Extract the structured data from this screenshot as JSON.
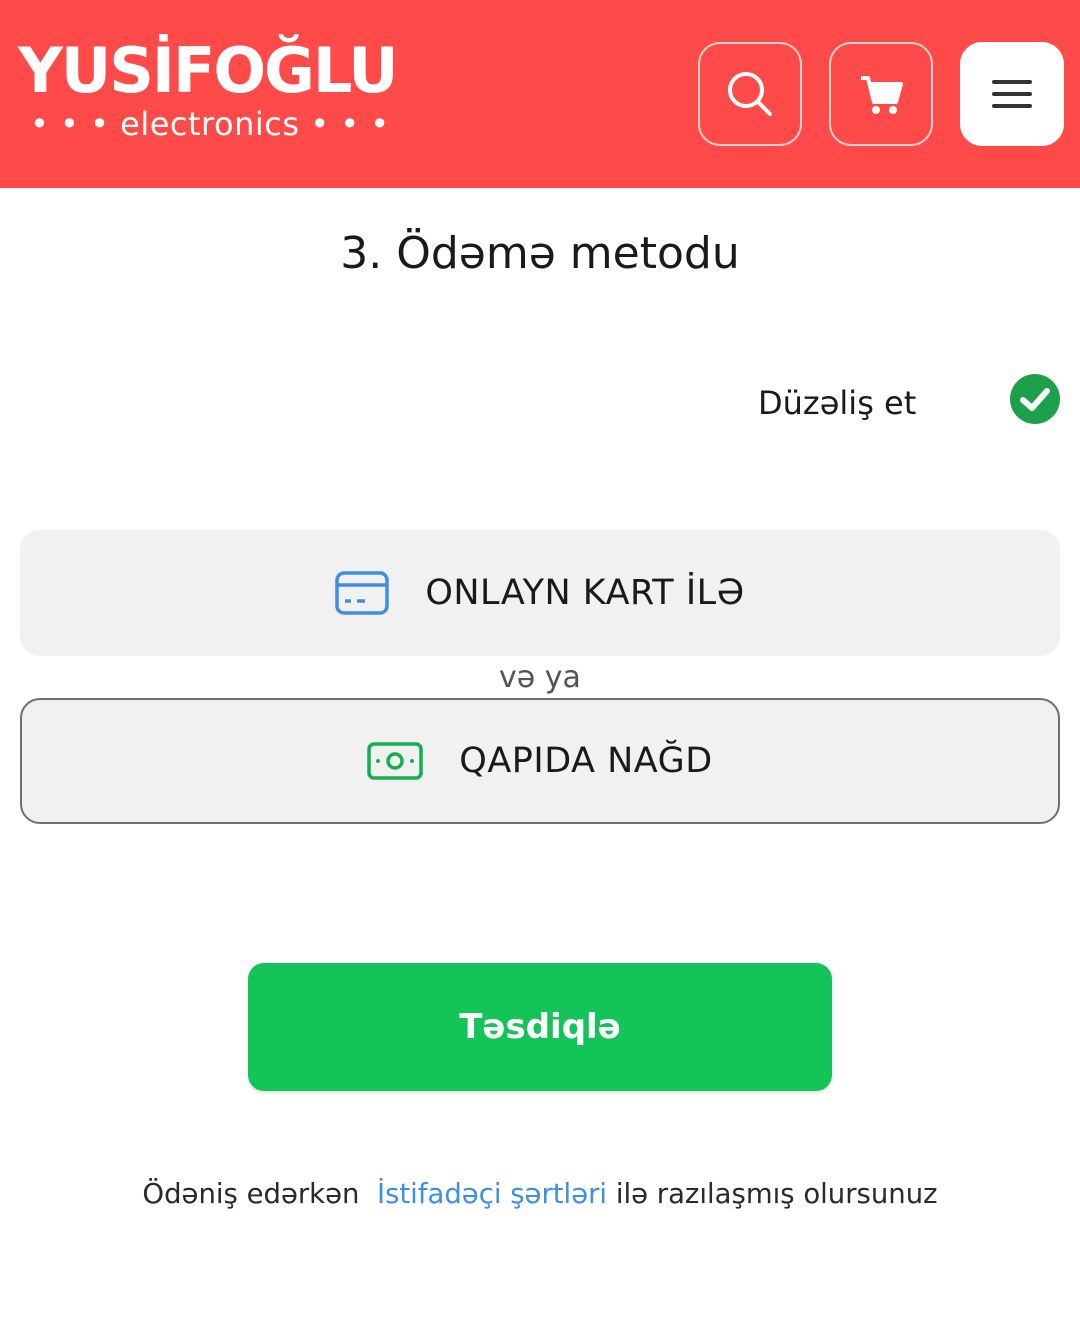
{
  "header": {
    "logo_title": "YUSİFOĞLU",
    "logo_subtitle": "• • • electronics • • •",
    "search_icon": "search-icon",
    "cart_icon": "cart-icon",
    "menu_icon": "hamburger-menu-icon",
    "brand_color": "#ff4a4a"
  },
  "main": {
    "title": "3. Ödəmə metodu",
    "edit_label": "Düzəliş et",
    "edit_status_icon": "check-circle-icon",
    "options": [
      {
        "label": "ONLAYN KART İLƏ",
        "icon": "credit-card-icon",
        "icon_color": "#3f8ee6"
      },
      {
        "label": "QAPIDA NAĞD",
        "icon": "cash-icon",
        "icon_color": "#14b050"
      }
    ],
    "or_text": "və ya",
    "confirm_label": "Təsdiqlə",
    "confirm_color": "#14c458"
  },
  "terms": {
    "prefix": "Ödəniş edərkən",
    "link": "İstifadəçi şərtləri",
    "suffix": "ilə razılaşmış olursunuz"
  }
}
